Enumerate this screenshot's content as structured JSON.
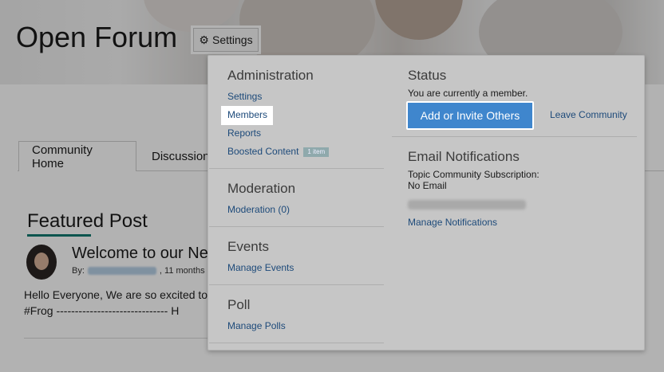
{
  "page": {
    "title": "Open Forum",
    "settings_button": "Settings"
  },
  "tabs": [
    {
      "label": "Community Home",
      "active": true
    },
    {
      "label": "Discussion",
      "active": false
    }
  ],
  "featured": {
    "heading": "Featured Post",
    "post_title": "Welcome to our Ne",
    "by_label": "By:",
    "time_ago": ", 11 months",
    "body_line1": "Hello Everyone, We are so excited to",
    "body_line2": "#Frog ------------------------------ H"
  },
  "dropdown": {
    "administration": {
      "heading": "Administration",
      "links": [
        "Settings",
        "Members",
        "Reports",
        "Boosted Content"
      ],
      "boosted_badge": "1 item"
    },
    "moderation": {
      "heading": "Moderation",
      "link": "Moderation (0)"
    },
    "events": {
      "heading": "Events",
      "link": "Manage Events"
    },
    "poll": {
      "heading": "Poll",
      "link": "Manage Polls"
    },
    "status": {
      "heading": "Status",
      "text": "You are currently a member.",
      "invite_button": "Add or Invite Others",
      "leave_link": "Leave Community"
    },
    "email": {
      "heading": "Email Notifications",
      "subscription_label": "Topic Community Subscription:",
      "subscription_value": "No Email",
      "manage_link": "Manage Notifications"
    }
  },
  "colors": {
    "link": "#1d4a7a",
    "accent_button": "#3f86cd",
    "featured_underline": "#137a72"
  }
}
